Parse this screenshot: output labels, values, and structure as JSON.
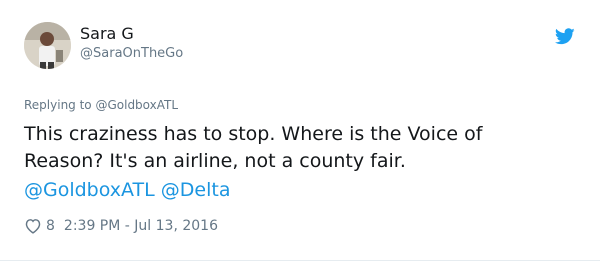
{
  "tweet": {
    "author_name": "Sara G",
    "author_handle": "@SaraOnTheGo",
    "replying_to": "Replying to @GoldboxATL",
    "text_lines": [
      "This craziness has to stop. Where is the Voice of",
      "Reason? It's an airline, not a county fair."
    ],
    "mentions": [
      "@GoldboxATL",
      "@Delta"
    ],
    "like_count": "8",
    "timestamp": "2:39 PM - Jul 13, 2016"
  },
  "icons": {
    "brand": "twitter-bird-icon",
    "like": "heart-icon"
  },
  "colors": {
    "link": "#1b95e0",
    "muted": "#657786",
    "text": "#14171a",
    "brand": "#1da1f2"
  }
}
